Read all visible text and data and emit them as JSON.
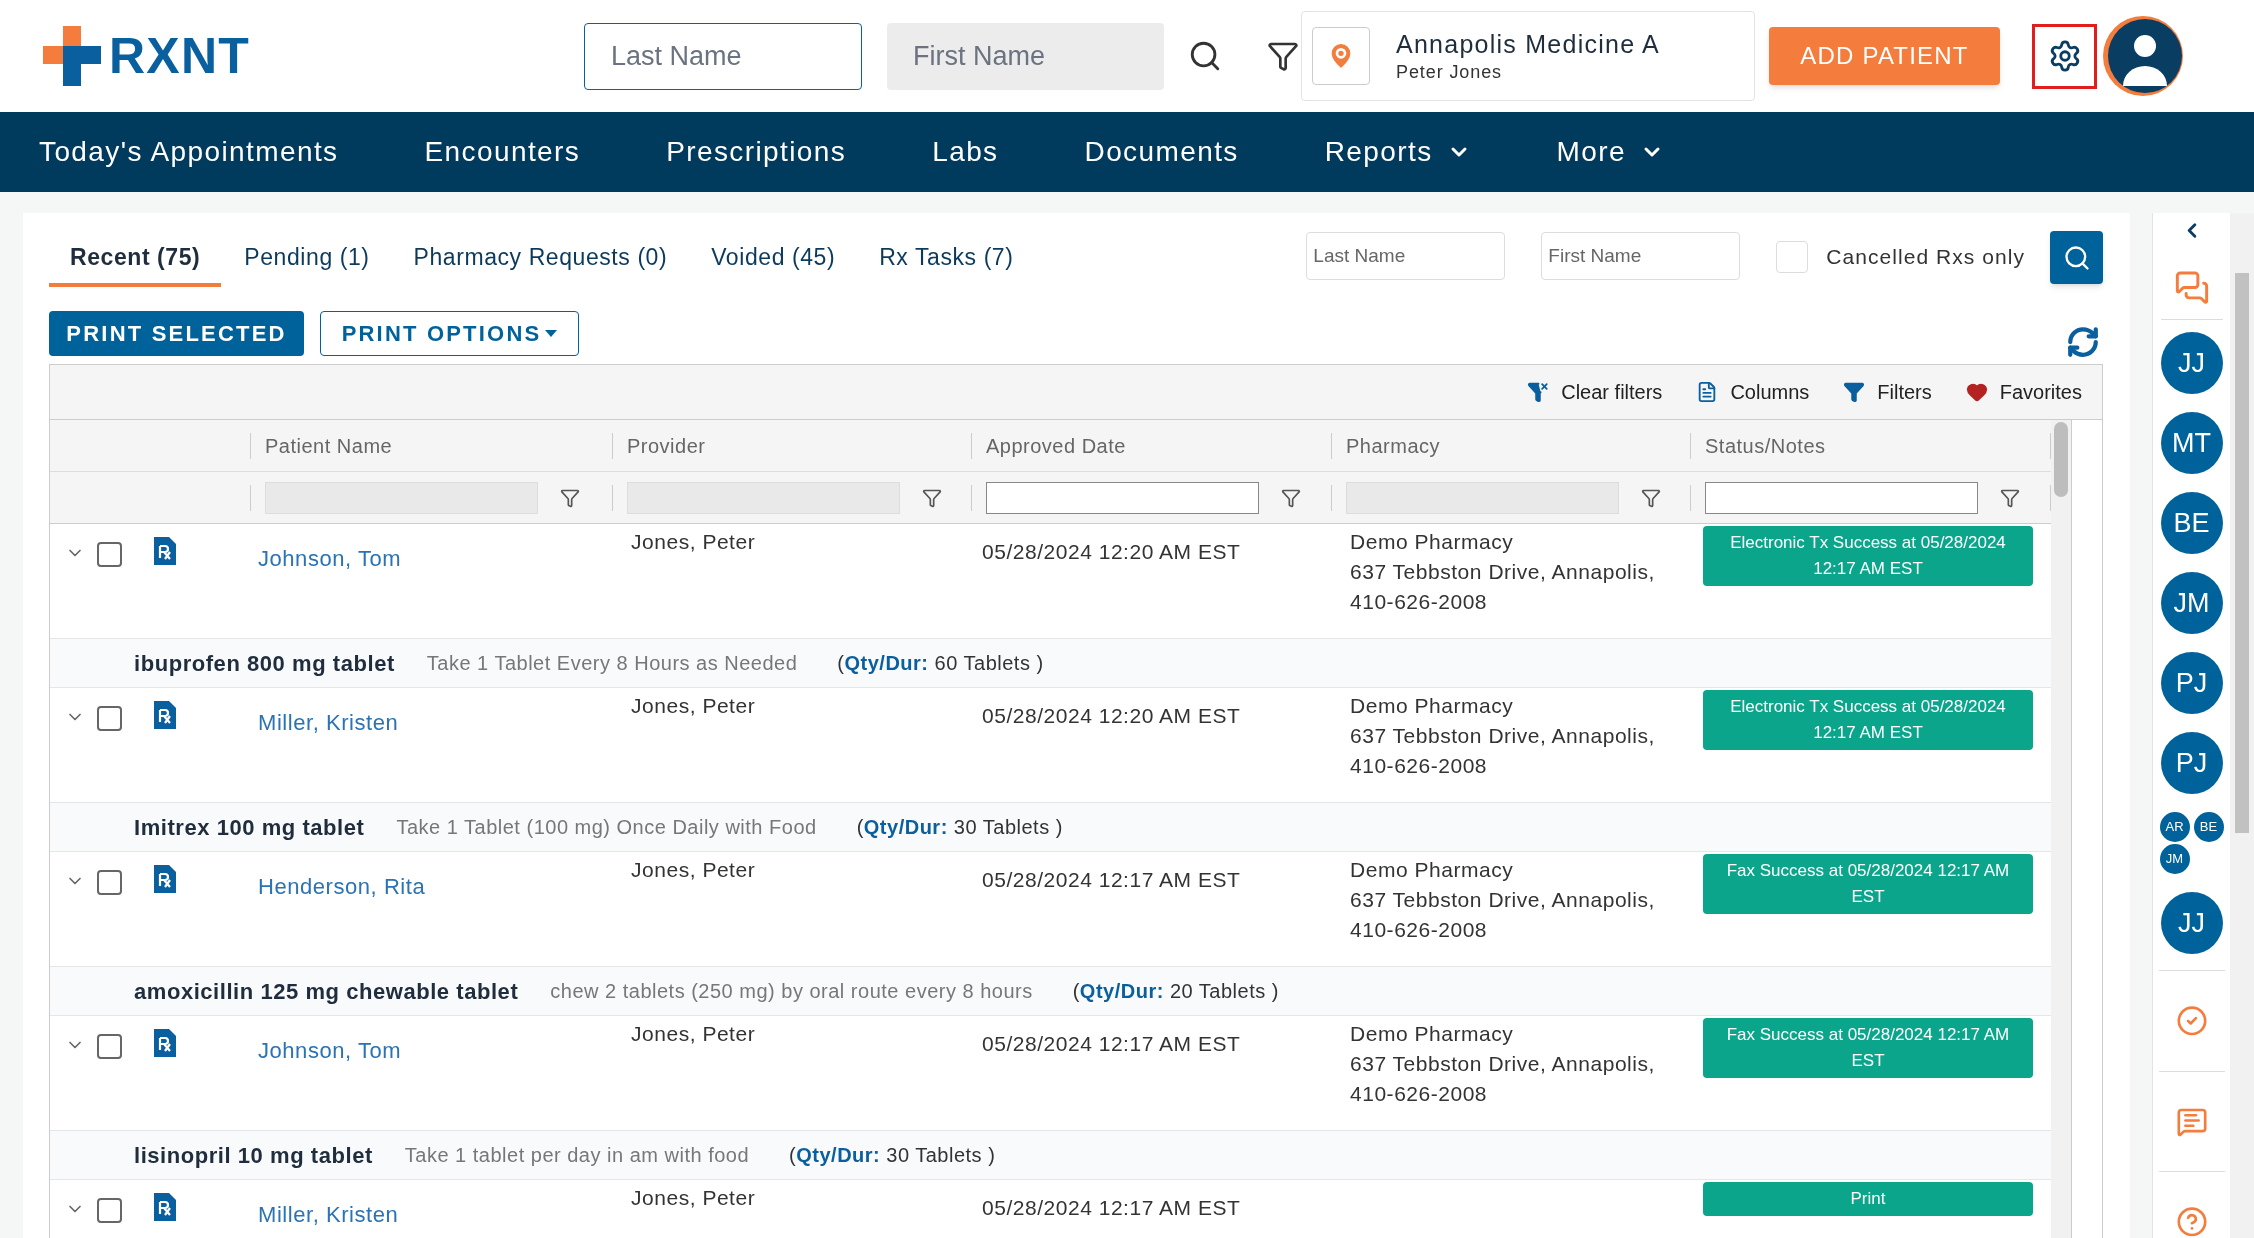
{
  "logo": {
    "text": "RXNT"
  },
  "header_search": {
    "last_name": {
      "placeholder": "Last Name"
    },
    "first_name": {
      "placeholder": "First Name"
    }
  },
  "location": {
    "name": "Annapolis Medicine A",
    "user": "Peter Jones"
  },
  "add_patient_button": "ADD PATIENT",
  "nav": [
    {
      "label": "Today's Appointments",
      "dropdown": false
    },
    {
      "label": "Encounters",
      "dropdown": false
    },
    {
      "label": "Prescriptions",
      "dropdown": false
    },
    {
      "label": "Labs",
      "dropdown": false
    },
    {
      "label": "Documents",
      "dropdown": false
    },
    {
      "label": "Reports",
      "dropdown": true
    },
    {
      "label": "More",
      "dropdown": true
    }
  ],
  "tabs": [
    {
      "label": "Recent (75)",
      "selected": true
    },
    {
      "label": "Pending (1)",
      "selected": false
    },
    {
      "label": "Pharmacy Requests (0)",
      "selected": false
    },
    {
      "label": "Voided (45)",
      "selected": false
    },
    {
      "label": "Rx Tasks (7)",
      "selected": false
    }
  ],
  "filters": {
    "last_name": {
      "placeholder": "Last Name"
    },
    "first_name": {
      "placeholder": "First Name"
    },
    "cancelled_only": {
      "label": "Cancelled Rxs only",
      "checked": false
    }
  },
  "buttons": {
    "print_selected": "PRINT SELECTED",
    "print_options": "PRINT OPTIONS"
  },
  "toolbar": [
    {
      "kind": "clear",
      "label": "Clear filters"
    },
    {
      "kind": "columns",
      "label": "Columns"
    },
    {
      "kind": "filters",
      "label": "Filters"
    },
    {
      "kind": "favorites",
      "label": "Favorites"
    }
  ],
  "table": {
    "columns": [
      {
        "label": "Patient Name",
        "filter_disabled": true
      },
      {
        "label": "Provider",
        "filter_disabled": true
      },
      {
        "label": "Approved Date",
        "filter_disabled": false
      },
      {
        "label": "Pharmacy",
        "filter_disabled": true
      },
      {
        "label": "Status/Notes",
        "filter_disabled": false
      }
    ],
    "rows": [
      {
        "patient": "Johnson, Tom",
        "provider": "Jones, Peter",
        "date": "05/28/2024 12:20 AM EST",
        "pharmacy": [
          "Demo Pharmacy",
          "637 Tebbston Drive, Annapolis,",
          "410-626-2008"
        ],
        "status": "Electronic Tx Success at 05/28/2024 12:17 AM EST",
        "checked": false,
        "drug": {
          "name": "ibuprofen 800 mg tablet",
          "sig": "Take 1 Tablet Every 8 Hours as Needed",
          "qty": "(**Qty/Dur:** 60 Tablets )"
        }
      },
      {
        "patient": "Miller, Kristen",
        "provider": "Jones, Peter",
        "date": "05/28/2024 12:20 AM EST",
        "pharmacy": [
          "Demo Pharmacy",
          "637 Tebbston Drive, Annapolis,",
          "410-626-2008"
        ],
        "status": "Electronic Tx Success at 05/28/2024 12:17 AM EST",
        "checked": false,
        "drug": {
          "name": "Imitrex 100 mg tablet",
          "sig": "Take 1 Tablet (100 mg) Once Daily with Food",
          "qty": "(**Qty/Dur:** 30 Tablets )"
        }
      },
      {
        "patient": "Henderson, Rita",
        "provider": "Jones, Peter",
        "date": "05/28/2024 12:17 AM EST",
        "pharmacy": [
          "Demo Pharmacy",
          "637 Tebbston Drive, Annapolis,",
          "410-626-2008"
        ],
        "status": "Fax Success at 05/28/2024 12:17 AM EST",
        "checked": false,
        "drug": {
          "name": "amoxicillin 125 mg chewable tablet",
          "sig": "chew 2 tablets (250 mg) by oral route every 8 hours",
          "qty": "(**Qty/Dur:** 20 Tablets )"
        }
      },
      {
        "patient": "Johnson, Tom",
        "provider": "Jones, Peter",
        "date": "05/28/2024 12:17 AM EST",
        "pharmacy": [
          "Demo Pharmacy",
          "637 Tebbston Drive, Annapolis,",
          "410-626-2008"
        ],
        "status": "Fax Success at 05/28/2024 12:17 AM EST",
        "checked": false,
        "drug": {
          "name": "lisinopril 10 mg tablet",
          "sig": "Take 1 tablet per day in am with food",
          "qty": "(**Qty/Dur:** 30 Tablets )"
        }
      },
      {
        "patient": "Miller, Kristen",
        "provider": "Jones, Peter",
        "date": "05/28/2024 12:17 AM EST",
        "status": "Print",
        "checked": false
      }
    ]
  },
  "sidebar_avatars": [
    {
      "initials": "JJ",
      "small": false
    },
    {
      "initials": "MT",
      "small": false
    },
    {
      "initials": "BE",
      "small": false
    },
    {
      "initials": "JM",
      "small": false
    },
    {
      "initials": "PJ",
      "small": false
    },
    {
      "initials": "PJ",
      "small": false
    },
    {
      "initials": "AR",
      "small": true
    },
    {
      "initials": "BE",
      "small": true
    },
    {
      "initials": "JM",
      "small": true
    },
    {
      "initials": "JJ",
      "small": false
    }
  ]
}
